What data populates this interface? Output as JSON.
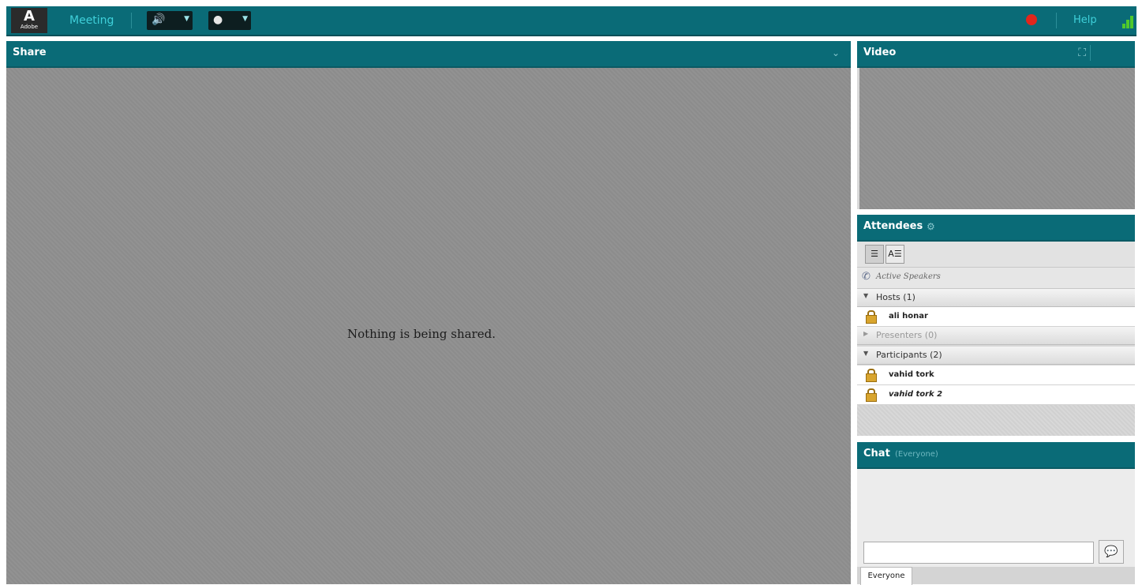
{
  "topbar": {
    "logo_text": "Adobe",
    "menu_meeting": "Meeting",
    "help_label": "Help"
  },
  "share": {
    "title": "Share",
    "message": "Nothing is being shared."
  },
  "video": {
    "title": "Video"
  },
  "attendees": {
    "title": "Attendees",
    "active_speakers": "Active Speakers",
    "groups": {
      "hosts": "Hosts (1)",
      "presenters": "Presenters (0)",
      "participants": "Participants (2)"
    },
    "hosts": [
      "ali honar"
    ],
    "participants": [
      "vahid tork",
      "vahid tork 2"
    ]
  },
  "chat": {
    "title": "Chat",
    "subtitle": "(Everyone)",
    "input_value": "",
    "tab_everyone": "Everyone"
  },
  "colors": {
    "brand_teal": "#0a6b77",
    "record_red": "#e1261c",
    "signal_green": "#4fc92b"
  },
  "icons": [
    "adobe-logo",
    "speaker-icon",
    "webcam-icon",
    "record-icon",
    "signal-icon",
    "fullscreen-icon",
    "phone-icon",
    "lock-icon",
    "chat-bubble-icon"
  ]
}
